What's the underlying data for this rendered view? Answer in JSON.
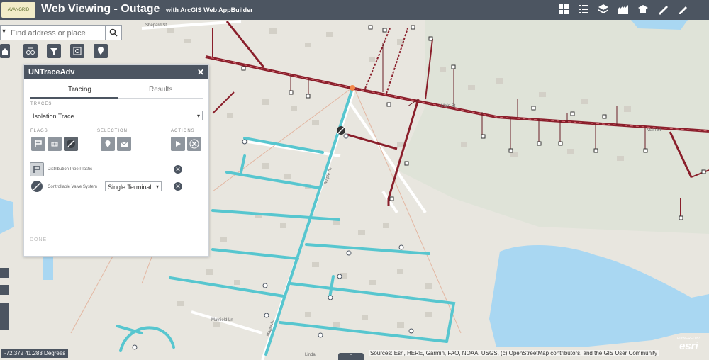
{
  "header": {
    "logo_text": "AVANGRID",
    "title": "Web Viewing - Outage",
    "subtitle": "with ArcGIS Web AppBuilder",
    "tools": [
      {
        "icon": "basemap-gallery-icon"
      },
      {
        "icon": "legend-icon"
      },
      {
        "icon": "layer-list-icon"
      },
      {
        "icon": "bookmark-icon"
      },
      {
        "icon": "print-icon"
      },
      {
        "icon": "measure-icon"
      },
      {
        "icon": "draw-icon"
      }
    ],
    "bg_color": "#4c5561"
  },
  "search": {
    "placeholder": "Find address or place"
  },
  "map_toolbar": [
    {
      "icon": "home-icon"
    },
    {
      "icon": "trace-icon"
    },
    {
      "icon": "filter-icon"
    },
    {
      "icon": "query-icon"
    },
    {
      "icon": "locate-icon"
    }
  ],
  "panel": {
    "title": "UNTraceAdv",
    "tabs": [
      "Tracing",
      "Results"
    ],
    "traces_label": "TRACES",
    "trace_selected": "Isolation Trace",
    "flags_label": "FLAGS",
    "selection_label": "SELECTION",
    "actions_label": "ACTIONS",
    "rows": [
      {
        "label": "Distribution Pipe Plastic"
      },
      {
        "label": "Controllable Valve System",
        "option": "Single Terminal"
      }
    ],
    "done_label": "DONE"
  },
  "map": {
    "streets": [
      "Shepard St",
      "Main St",
      "Main St",
      "Maple Av",
      "Maple Av",
      "Mayfield Ln",
      "Linda"
    ],
    "coords": "-72.372 41.283 Degrees",
    "attribution": "Sources: Esri, HERE, Garmin, FAO, NOAA, USGS, (c) OpenStreetMap contributors, and the GIS User Community",
    "esri_label": "esri",
    "powered_by": "POWERED BY",
    "colors": {
      "land": "#e8e6df",
      "water": "#a9d7f2",
      "trace": "#57c6cf",
      "gas_main": "#8a1f2b"
    }
  }
}
